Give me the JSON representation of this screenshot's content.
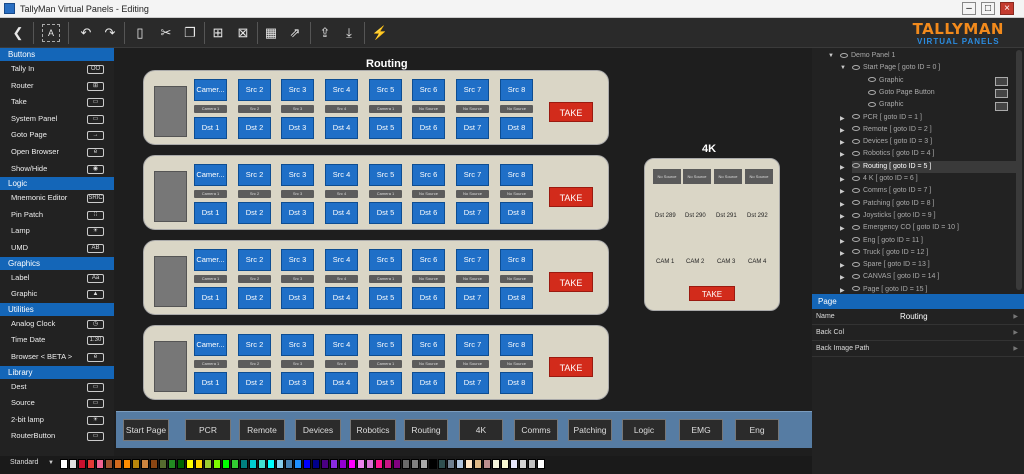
{
  "window": {
    "title": "TallyMan Virtual Panels - Editing"
  },
  "logo": {
    "line1": "TALLYMAN",
    "line2": "VIRTUAL PANELS"
  },
  "palette": {
    "sections": [
      {
        "title": "Buttons",
        "items": [
          {
            "label": "Tally In",
            "icon": "OO"
          },
          {
            "label": "Router",
            "icon": "⊞"
          },
          {
            "label": "Take",
            "icon": "▭"
          },
          {
            "label": "System Panel",
            "icon": "▭"
          },
          {
            "label": "Goto Page",
            "icon": "→"
          },
          {
            "label": "Open Browser",
            "icon": "e"
          },
          {
            "label": "Show/Hide",
            "icon": "◉"
          }
        ]
      },
      {
        "title": "Logic",
        "items": [
          {
            "label": "Mnemonic Editor",
            "icon": "SRIC"
          },
          {
            "label": "Pin Patch",
            "icon": "⁞⁞"
          },
          {
            "label": "Lamp",
            "icon": "☀"
          },
          {
            "label": "UMD",
            "icon": "AB"
          }
        ]
      },
      {
        "title": "Graphics",
        "items": [
          {
            "label": "Label",
            "icon": "Aa"
          },
          {
            "label": "Graphic",
            "icon": "▲"
          }
        ]
      },
      {
        "title": "Utilities",
        "items": [
          {
            "label": "Analog Clock",
            "icon": "◷"
          },
          {
            "label": "Time Date",
            "icon": "1:30"
          },
          {
            "label": "Browser < BETA >",
            "icon": "e"
          }
        ]
      },
      {
        "title": "Library",
        "items": [
          {
            "label": "Dest",
            "icon": "▭"
          },
          {
            "label": "Source",
            "icon": "▭"
          },
          {
            "label": "2-bit lamp",
            "icon": "☀"
          },
          {
            "label": "RouterButton",
            "icon": "▭"
          }
        ]
      }
    ],
    "footer": "Standard"
  },
  "canvas": {
    "title": "Routing",
    "panels": [
      {
        "sources": [
          "Camer...",
          "Src 2",
          "Src 3",
          "Src 4",
          "Src 5",
          "Src 6",
          "Src 7",
          "Src 8"
        ],
        "mids": [
          "Camera 1",
          "Src 2",
          "Src 3",
          "Src 4",
          "Camera 1",
          "No Source",
          "No Source",
          "No Source"
        ],
        "dests": [
          "Dst 1",
          "Dst 2",
          "Dst 3",
          "Dst 4",
          "Dst 5",
          "Dst 6",
          "Dst 7",
          "Dst 8"
        ],
        "take": "TAKE"
      },
      {
        "sources": [
          "Camer...",
          "Src 2",
          "Src 3",
          "Src 4",
          "Src 5",
          "Src 6",
          "Src 7",
          "Src 8"
        ],
        "mids": [
          "Camera 1",
          "Src 2",
          "Src 3",
          "Src 4",
          "Camera 1",
          "No Source",
          "No Source",
          "No Source"
        ],
        "dests": [
          "Dst 1",
          "Dst 2",
          "Dst 3",
          "Dst 4",
          "Dst 5",
          "Dst 6",
          "Dst 7",
          "Dst 8"
        ],
        "take": "TAKE"
      },
      {
        "sources": [
          "Camer...",
          "Src 2",
          "Src 3",
          "Src 4",
          "Src 5",
          "Src 6",
          "Src 7",
          "Src 8"
        ],
        "mids": [
          "Camera 1",
          "Src 2",
          "Src 3",
          "Src 4",
          "Camera 1",
          "No Source",
          "No Source",
          "No Source"
        ],
        "dests": [
          "Dst 1",
          "Dst 2",
          "Dst 3",
          "Dst 4",
          "Dst 5",
          "Dst 6",
          "Dst 7",
          "Dst 8"
        ],
        "take": "TAKE"
      },
      {
        "sources": [
          "Camer...",
          "Src 2",
          "Src 3",
          "Src 4",
          "Src 5",
          "Src 6",
          "Src 7",
          "Src 8"
        ],
        "mids": [
          "Camera 1",
          "Src 2",
          "Src 3",
          "Src 4",
          "Camera 1",
          "No Source",
          "No Source",
          "No Source"
        ],
        "dests": [
          "Dst 1",
          "Dst 2",
          "Dst 3",
          "Dst 4",
          "Dst 5",
          "Dst 6",
          "Dst 7",
          "Dst 8"
        ],
        "take": "TAKE"
      }
    ],
    "panel4k": {
      "title": "4K",
      "sources": [
        "No Source",
        "No Source",
        "No Source",
        "No Source"
      ],
      "dests": [
        "Dst 289",
        "Dst 290",
        "Dst 291",
        "Dst 292"
      ],
      "cams": [
        "CAM 1",
        "CAM 2",
        "CAM 3",
        "CAM 4"
      ],
      "take": "TAKE"
    },
    "nav": [
      "Start Page",
      "PCR",
      "Remote",
      "Devices",
      "Robotics",
      "Routing",
      "4K",
      "Comms",
      "Patching",
      "Logic",
      "EMG",
      "Eng"
    ]
  },
  "tree": {
    "root": "Demo Panel 1",
    "start": "Start Page [ goto ID = 0 ]",
    "start_children": [
      "Graphic",
      "Goto Page Button",
      "Graphic"
    ],
    "pages": [
      "PCR [ goto ID = 1 ]",
      "Remote [ goto ID = 2 ]",
      "Devices [ goto ID = 3 ]",
      "Robotics [ goto ID = 4 ]",
      "Routing [ goto ID = 5 ]",
      "4 K [ goto ID = 6 ]",
      "Comms [ goto ID = 7 ]",
      "Patching [ goto ID = 8 ]",
      "Joysticks [ goto ID = 9 ]",
      "Emergency CO [ goto ID = 10 ]",
      "Eng [ goto ID = 11 ]",
      "Truck [ goto ID = 12 ]",
      "Spare [ goto ID = 13 ]",
      "CANVAS [ goto ID = 14 ]",
      "Page [ goto ID = 15 ]"
    ],
    "selected_index": 4
  },
  "properties": {
    "header": "Page",
    "rows": [
      {
        "key": "Name",
        "value": "Routing"
      },
      {
        "key": "Back Col",
        "value": ""
      },
      {
        "key": "Back Image Path",
        "value": ""
      }
    ]
  },
  "colors": {
    "accent": "#1466b8",
    "take": "#d22b1b",
    "source_btn": "#1f6fc7",
    "panel_bg": "#dad6c6",
    "nav_bar": "#567ca3",
    "logo_orange": "#f28a1c",
    "logo_blue": "#2b8ce0"
  },
  "swatches": [
    "#ffffff",
    "#e0e0e0",
    "#c8102e",
    "#e53935",
    "#f06292",
    "#a0522d",
    "#d2691e",
    "#ff8c00",
    "#b8860b",
    "#cd853f",
    "#8b4513",
    "#556b2f",
    "#228b22",
    "#006400",
    "#ffff00",
    "#ffd700",
    "#9acd32",
    "#7cfc00",
    "#00ff00",
    "#32cd32",
    "#008080",
    "#00ced1",
    "#40e0d0",
    "#00ffff",
    "#87ceeb",
    "#4682b4",
    "#1e90ff",
    "#0000ff",
    "#00008b",
    "#4b0082",
    "#8a2be2",
    "#9400d3",
    "#ff00ff",
    "#ee82ee",
    "#da70d6",
    "#ff1493",
    "#c71585",
    "#800080",
    "#696969",
    "#808080",
    "#a9a9a9",
    "#000000",
    "#2f4f4f",
    "#708090",
    "#b0c4de",
    "#ffe4c4",
    "#deb887",
    "#bc8f8f",
    "#f5f5dc",
    "#fafad2",
    "#e6e6fa",
    "#d3d3d3",
    "#c0c0c0",
    "#ffffff"
  ]
}
